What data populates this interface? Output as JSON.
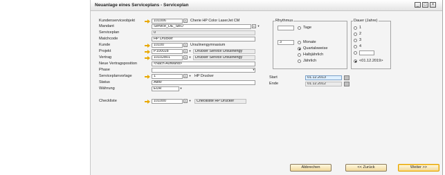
{
  "window": {
    "title": "Neuanlage eines Serviceplans - Serviceplan",
    "minimize_glyph": "_",
    "maximize_glyph": "□",
    "close_glyph": "×"
  },
  "form": {
    "kundenserviceobjekt": {
      "label": "Kundenserviceobjekt",
      "value": "101006",
      "description": "Cherie HP Color LaserJet CM"
    },
    "mandant": {
      "label": "Mandant",
      "value": "Service_DE_SBO"
    },
    "serviceplan": {
      "label": "Serviceplan",
      "value": "0"
    },
    "matchcode": {
      "label": "Matchcode",
      "value": "HP Drucker"
    },
    "kunde": {
      "label": "Kunde",
      "value": "10100",
      "description": "Ursulinengymnasium"
    },
    "projekt": {
      "label": "Projekt",
      "value": "P100028",
      "description": "Drucker Service Ursulinengy"
    },
    "vertrag": {
      "label": "Vertrag",
      "value": "10102801",
      "description": "Drucker Service Ursulinengy"
    },
    "neue_vertragsposition": {
      "label": "Neue Vertragsposition",
      "value": "<Nach Aufwand>"
    },
    "phase": {
      "label": "Phase",
      "value": ""
    },
    "serviceplanvorlage": {
      "label": "Serviceplanvorlage",
      "value": "1",
      "description": "HP Drucker"
    },
    "status": {
      "label": "Status",
      "value": "Aktiv"
    },
    "waehrung": {
      "label": "Währung",
      "value": "EUR"
    },
    "checkliste": {
      "label": "Checkliste",
      "value": "101000",
      "description": "Checkliste HP Drucker"
    }
  },
  "rhythmus": {
    "label": "Rhythmus",
    "options": [
      {
        "label": "Tage",
        "value": "",
        "selected": false
      },
      {
        "label": "Monate",
        "value": "3",
        "selected": false
      },
      {
        "label": "Quartalsweise",
        "selected": true
      },
      {
        "label": "Halbjährlich",
        "selected": false
      },
      {
        "label": "Jährlich",
        "selected": false
      }
    ]
  },
  "dauer": {
    "label": "Dauer (Jahre)",
    "options": [
      {
        "label": "1",
        "selected": false
      },
      {
        "label": "2",
        "selected": false
      },
      {
        "label": "3",
        "selected": false
      },
      {
        "label": "4",
        "selected": false
      },
      {
        "label": "",
        "selected": false
      },
      {
        "label": "<01.12.2019>",
        "selected": true
      }
    ]
  },
  "dates": {
    "start": {
      "label": "Start",
      "value": "01.12.2013"
    },
    "ende": {
      "label": "Ende",
      "value": "01.12.2012"
    }
  },
  "buttons": {
    "cancel": "Abbrechen",
    "back": "<< Zurück",
    "next": "Weiter >>"
  },
  "colors": {
    "link_arrow": "#e8a800",
    "button_face": "#f1d89a",
    "highlight_field": "#dff0ff"
  }
}
